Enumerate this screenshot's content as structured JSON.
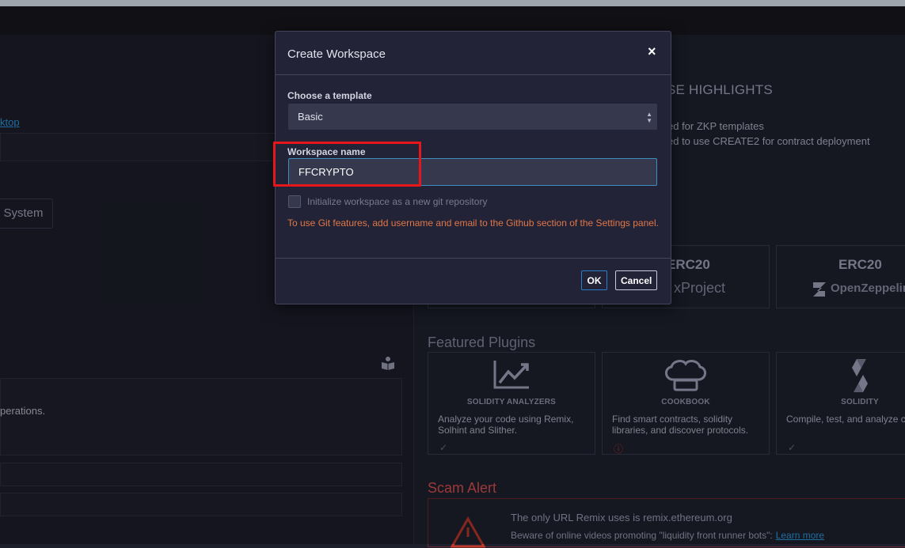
{
  "left": {
    "desktop_link": "ktop",
    "file_system_button": "e System",
    "operations_text": "perations."
  },
  "highlights": {
    "title": "SE HIGHLIGHTS",
    "line1": "ed for ZKP templates",
    "line2": "ed to use CREATE2 for contract deployment"
  },
  "templates": [
    {
      "title": "ERC20",
      "subtitle": "xProject"
    },
    {
      "title": "ERC20",
      "subtitle": "OpenZeppelin"
    }
  ],
  "featured": {
    "title": "Featured Plugins",
    "plugins": [
      {
        "name": "SOLIDITY ANALYZERS",
        "desc": "Analyze your code using Remix, Solhint and Slither.",
        "icon": "chart-line-icon",
        "status": "✓"
      },
      {
        "name": "COOKBOOK",
        "desc": "Find smart contracts, solidity libraries, and discover protocols.",
        "icon": "chef-hat-icon",
        "status": "ⓘ"
      },
      {
        "name": "SOLIDITY",
        "desc": "Compile, test, and analyze contracts.",
        "icon": "solidity-icon",
        "status": "✓"
      }
    ]
  },
  "scam": {
    "title": "Scam Alert",
    "line1": "The only URL Remix uses is remix.ethereum.org",
    "line2": "Beware of online videos promoting \"liquidity front runner bots\":",
    "learn_more": "Learn more"
  },
  "modal": {
    "title": "Create Workspace",
    "close": "×",
    "template_label": "Choose a template",
    "template_value": "Basic",
    "name_label": "Workspace name",
    "name_value": "FFCRYPTO",
    "git_label": "Initialize workspace as a new git repository",
    "git_warning": "To use Git features, add username and email to the Github section of the Settings panel.",
    "ok": "OK",
    "cancel": "Cancel"
  }
}
